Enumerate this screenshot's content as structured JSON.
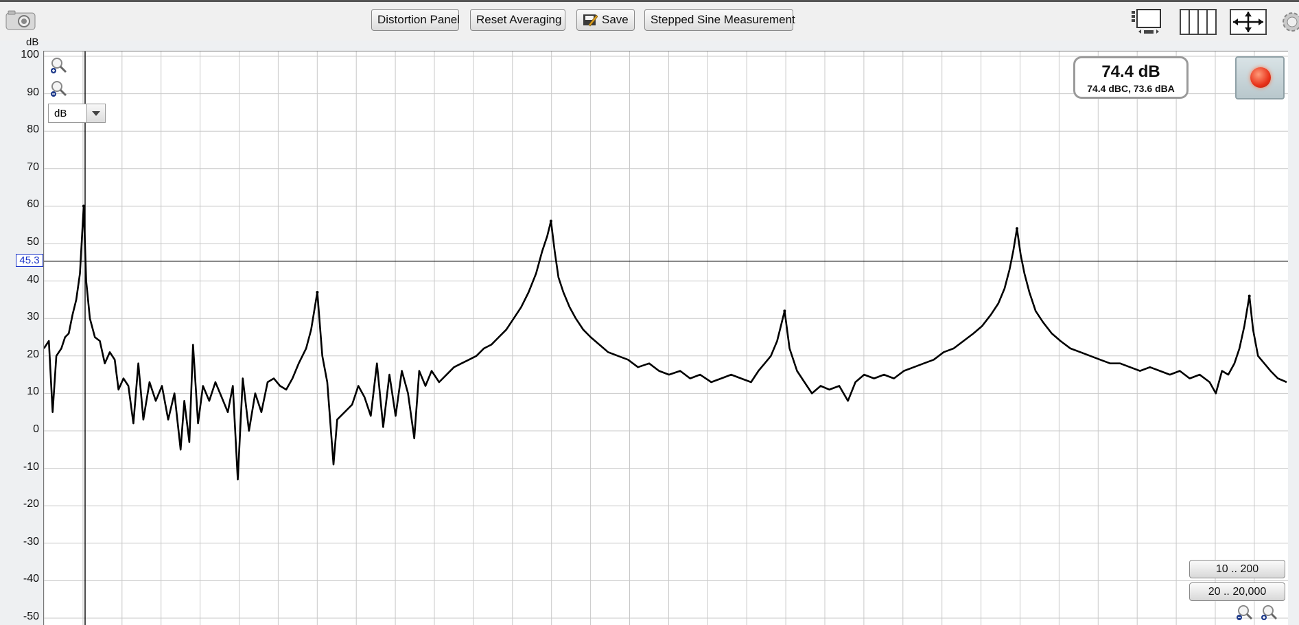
{
  "toolbar": {
    "distortion_label": "Distortion Panel",
    "reset_label": "Reset Averaging",
    "save_label": "Save",
    "stepped_label": "Stepped Sine Measurement"
  },
  "graph": {
    "y_unit": "dB",
    "unit_select_value": "dB",
    "cursor_value": "45.3",
    "level_main": "74.4 dB",
    "level_sub": "74.4 dBC, 73.6 dBA",
    "range_buttons": [
      "10 .. 200",
      "20 .. 20,000"
    ]
  },
  "colors": {
    "trace": "#000000",
    "cursor_badge": "#1a34c8",
    "record": "#e8321a"
  },
  "chart_data": {
    "type": "line",
    "title": "",
    "xlabel": "",
    "ylabel": "dB",
    "ylim": [
      -50,
      100
    ],
    "grid": true,
    "yticks": [
      "100",
      "90",
      "80",
      "70",
      "60",
      "50",
      "40",
      "30",
      "20",
      "10",
      "0",
      "-10",
      "-20",
      "-30",
      "-40",
      "-50"
    ],
    "cursor_y": 45.3,
    "peaks": [
      {
        "x": 0.032,
        "y": 60
      },
      {
        "x": 0.22,
        "y": 37
      },
      {
        "x": 0.408,
        "y": 56
      },
      {
        "x": 0.596,
        "y": 32
      },
      {
        "x": 0.783,
        "y": 54
      },
      {
        "x": 0.97,
        "y": 36
      }
    ],
    "series": [
      {
        "values": [
          [
            0.0,
            22
          ],
          [
            0.004,
            24
          ],
          [
            0.007,
            5
          ],
          [
            0.01,
            20
          ],
          [
            0.014,
            22
          ],
          [
            0.017,
            25
          ],
          [
            0.02,
            26
          ],
          [
            0.023,
            31
          ],
          [
            0.026,
            35
          ],
          [
            0.029,
            42
          ],
          [
            0.032,
            60
          ],
          [
            0.034,
            40
          ],
          [
            0.037,
            30
          ],
          [
            0.041,
            25
          ],
          [
            0.045,
            24
          ],
          [
            0.049,
            18
          ],
          [
            0.053,
            21
          ],
          [
            0.057,
            19
          ],
          [
            0.06,
            11
          ],
          [
            0.064,
            14
          ],
          [
            0.068,
            12
          ],
          [
            0.072,
            2
          ],
          [
            0.076,
            18
          ],
          [
            0.08,
            3
          ],
          [
            0.085,
            13
          ],
          [
            0.09,
            8
          ],
          [
            0.095,
            12
          ],
          [
            0.1,
            3
          ],
          [
            0.105,
            10
          ],
          [
            0.11,
            -5
          ],
          [
            0.113,
            8
          ],
          [
            0.117,
            -3
          ],
          [
            0.12,
            23
          ],
          [
            0.124,
            2
          ],
          [
            0.128,
            12
          ],
          [
            0.133,
            8
          ],
          [
            0.138,
            13
          ],
          [
            0.143,
            9
          ],
          [
            0.148,
            5
          ],
          [
            0.152,
            12
          ],
          [
            0.156,
            -13
          ],
          [
            0.16,
            14
          ],
          [
            0.165,
            0
          ],
          [
            0.17,
            10
          ],
          [
            0.175,
            5
          ],
          [
            0.18,
            13
          ],
          [
            0.185,
            14
          ],
          [
            0.19,
            12
          ],
          [
            0.195,
            11
          ],
          [
            0.2,
            14
          ],
          [
            0.205,
            18
          ],
          [
            0.211,
            22
          ],
          [
            0.215,
            27
          ],
          [
            0.22,
            37
          ],
          [
            0.224,
            20
          ],
          [
            0.228,
            13
          ],
          [
            0.233,
            -9
          ],
          [
            0.236,
            3
          ],
          [
            0.242,
            5
          ],
          [
            0.248,
            7
          ],
          [
            0.253,
            12
          ],
          [
            0.258,
            9
          ],
          [
            0.263,
            4
          ],
          [
            0.268,
            18
          ],
          [
            0.273,
            1
          ],
          [
            0.278,
            15
          ],
          [
            0.283,
            4
          ],
          [
            0.288,
            16
          ],
          [
            0.293,
            10
          ],
          [
            0.298,
            -2
          ],
          [
            0.302,
            16
          ],
          [
            0.307,
            12
          ],
          [
            0.312,
            16
          ],
          [
            0.318,
            13
          ],
          [
            0.324,
            15
          ],
          [
            0.33,
            17
          ],
          [
            0.336,
            18
          ],
          [
            0.342,
            19
          ],
          [
            0.348,
            20
          ],
          [
            0.354,
            22
          ],
          [
            0.36,
            23
          ],
          [
            0.366,
            25
          ],
          [
            0.372,
            27
          ],
          [
            0.378,
            30
          ],
          [
            0.384,
            33
          ],
          [
            0.39,
            37
          ],
          [
            0.396,
            42
          ],
          [
            0.401,
            48
          ],
          [
            0.405,
            52
          ],
          [
            0.408,
            56
          ],
          [
            0.411,
            48
          ],
          [
            0.414,
            41
          ],
          [
            0.418,
            37
          ],
          [
            0.423,
            33
          ],
          [
            0.428,
            30
          ],
          [
            0.434,
            27
          ],
          [
            0.44,
            25
          ],
          [
            0.447,
            23
          ],
          [
            0.454,
            21
          ],
          [
            0.462,
            20
          ],
          [
            0.47,
            19
          ],
          [
            0.478,
            17
          ],
          [
            0.487,
            18
          ],
          [
            0.495,
            16
          ],
          [
            0.503,
            15
          ],
          [
            0.512,
            16
          ],
          [
            0.52,
            14
          ],
          [
            0.528,
            15
          ],
          [
            0.537,
            13
          ],
          [
            0.545,
            14
          ],
          [
            0.553,
            15
          ],
          [
            0.561,
            14
          ],
          [
            0.569,
            13
          ],
          [
            0.575,
            16
          ],
          [
            0.58,
            18
          ],
          [
            0.585,
            20
          ],
          [
            0.59,
            24
          ],
          [
            0.596,
            32
          ],
          [
            0.6,
            22
          ],
          [
            0.606,
            16
          ],
          [
            0.612,
            13
          ],
          [
            0.618,
            10
          ],
          [
            0.625,
            12
          ],
          [
            0.632,
            11
          ],
          [
            0.64,
            12
          ],
          [
            0.647,
            8
          ],
          [
            0.653,
            13
          ],
          [
            0.66,
            15
          ],
          [
            0.668,
            14
          ],
          [
            0.676,
            15
          ],
          [
            0.684,
            14
          ],
          [
            0.692,
            16
          ],
          [
            0.7,
            17
          ],
          [
            0.708,
            18
          ],
          [
            0.716,
            19
          ],
          [
            0.724,
            21
          ],
          [
            0.732,
            22
          ],
          [
            0.74,
            24
          ],
          [
            0.748,
            26
          ],
          [
            0.755,
            28
          ],
          [
            0.762,
            31
          ],
          [
            0.768,
            34
          ],
          [
            0.773,
            38
          ],
          [
            0.777,
            43
          ],
          [
            0.78,
            48
          ],
          [
            0.783,
            54
          ],
          [
            0.786,
            47
          ],
          [
            0.789,
            42
          ],
          [
            0.793,
            37
          ],
          [
            0.798,
            32
          ],
          [
            0.804,
            29
          ],
          [
            0.811,
            26
          ],
          [
            0.818,
            24
          ],
          [
            0.826,
            22
          ],
          [
            0.834,
            21
          ],
          [
            0.842,
            20
          ],
          [
            0.85,
            19
          ],
          [
            0.858,
            18
          ],
          [
            0.866,
            18
          ],
          [
            0.874,
            17
          ],
          [
            0.882,
            16
          ],
          [
            0.89,
            17
          ],
          [
            0.898,
            16
          ],
          [
            0.906,
            15
          ],
          [
            0.914,
            16
          ],
          [
            0.922,
            14
          ],
          [
            0.93,
            15
          ],
          [
            0.938,
            13
          ],
          [
            0.943,
            10
          ],
          [
            0.948,
            16
          ],
          [
            0.953,
            15
          ],
          [
            0.958,
            18
          ],
          [
            0.962,
            22
          ],
          [
            0.966,
            28
          ],
          [
            0.97,
            36
          ],
          [
            0.973,
            27
          ],
          [
            0.977,
            20
          ],
          [
            0.982,
            18
          ],
          [
            0.987,
            16
          ],
          [
            0.993,
            14
          ],
          [
            1.0,
            13
          ]
        ]
      }
    ]
  }
}
